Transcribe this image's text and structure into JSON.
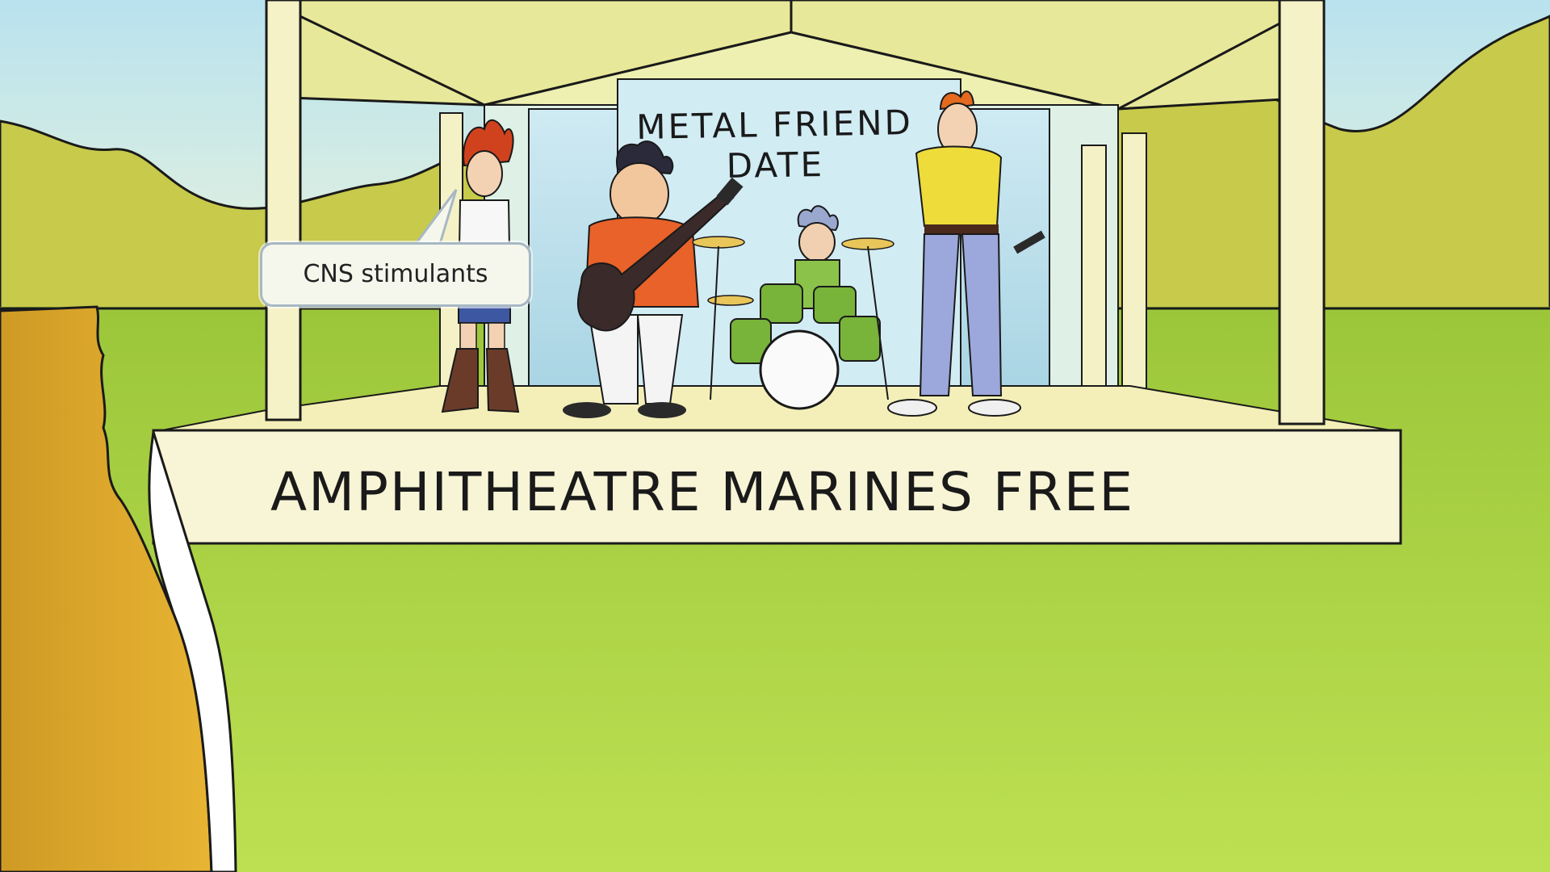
{
  "scene": {
    "stage_banner": "AMPHITHEATRE MARINES FREE",
    "backdrop_sign": {
      "line1": "METAL FRIEND",
      "line2": "DATE"
    },
    "speech_bubble": "CNS stimulants"
  },
  "colors": {
    "sky": "#cde9ee",
    "hills": "#c9c94a",
    "grass": "#b3d64c",
    "stage": "#f7f3cf",
    "roof": "#e9e99a",
    "backdrop": "#d4ecf2",
    "tree_trunk": "#dba72a"
  }
}
